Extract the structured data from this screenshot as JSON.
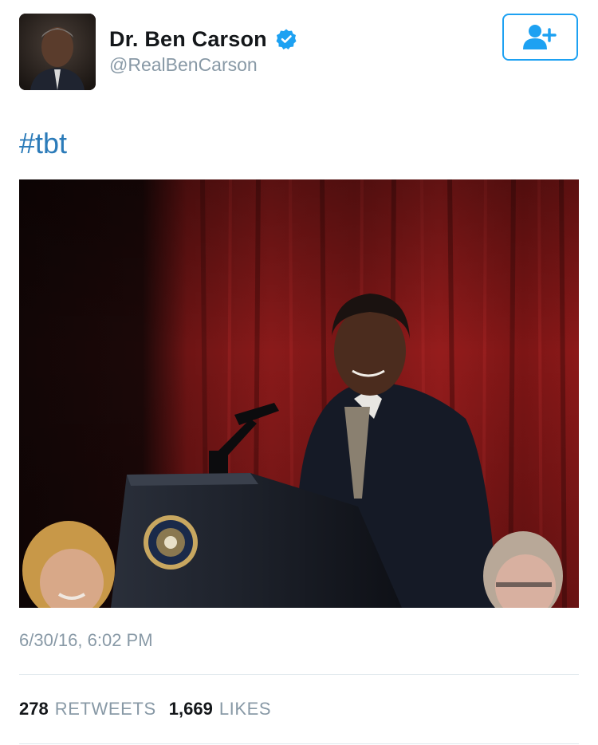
{
  "author": {
    "display_name": "Dr. Ben Carson",
    "handle": "@RealBenCarson",
    "verified": true,
    "avatar_icon": "profile-photo"
  },
  "actions": {
    "follow_icon": "add-user-icon"
  },
  "tweet": {
    "text": "#tbt",
    "media_icon": "photo"
  },
  "meta": {
    "timestamp": "6/30/16, 6:02 PM"
  },
  "stats": {
    "retweets_count": "278",
    "retweets_label": "RETWEETS",
    "likes_count": "1,669",
    "likes_label": "LIKES"
  },
  "colors": {
    "accent": "#1da1f2",
    "link": "#2b7bb9",
    "muted": "#8899a6",
    "text": "#14171a",
    "divider": "#e1e8ed"
  }
}
